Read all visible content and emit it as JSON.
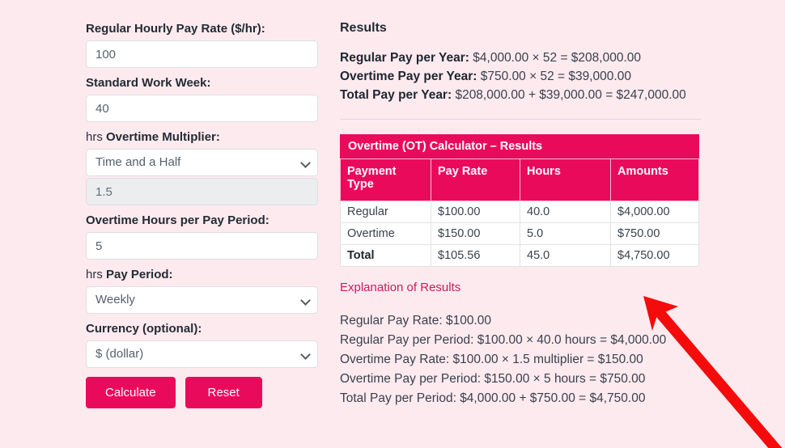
{
  "form": {
    "fields": [
      {
        "label": "Regular Hourly Pay Rate ($/hr):",
        "value": "100",
        "type": "text"
      },
      {
        "label": "Standard Work Week:",
        "value": "40",
        "type": "text"
      },
      {
        "label": "Overtime Multiplier:",
        "prefix": "hrs",
        "value": "Time and a Half",
        "type": "select"
      },
      {
        "label": "",
        "value": "1.5",
        "type": "text-disabled"
      },
      {
        "label": "Overtime Hours per Pay Period:",
        "value": "5",
        "type": "text"
      },
      {
        "label": "Pay Period:",
        "prefix": "hrs",
        "value": "Weekly",
        "type": "select"
      },
      {
        "label": "Currency (optional):",
        "value": "$ (dollar)",
        "type": "select"
      }
    ],
    "calculate_label": "Calculate",
    "reset_label": "Reset"
  },
  "results": {
    "heading": "Results",
    "summary": [
      {
        "label": "Regular Pay per Year:",
        "value": " $4,000.00 × 52 = $208,000.00"
      },
      {
        "label": "Overtime Pay per Year:",
        "value": " $750.00 × 52 = $39,000.00"
      },
      {
        "label": "Total Pay per Year:",
        "value": " $208,000.00 + $39,000.00 = $247,000.00"
      }
    ],
    "table": {
      "caption": "Overtime (OT) Calculator – Results",
      "headers": [
        "Payment Type",
        "Pay Rate",
        "Hours",
        "Amounts"
      ],
      "rows": [
        {
          "type": "Regular",
          "rate": "$100.00",
          "hours": "40.0",
          "amount": "$4,000.00"
        },
        {
          "type": "Overtime",
          "rate": "$150.00",
          "hours": "5.0",
          "amount": "$750.00"
        },
        {
          "type": "Total",
          "rate": "$105.56",
          "hours": "45.0",
          "amount": "$4,750.00"
        }
      ]
    },
    "explanation_link": "Explanation of Results",
    "explanation_lines": [
      "Regular Pay Rate: $100.00",
      "Regular Pay per Period: $100.00 × 40.0 hours = $4,000.00",
      "Overtime Pay Rate: $100.00 × 1.5 multiplier = $150.00",
      "Overtime Pay per Period: $150.00 × 5 hours = $750.00",
      "Total Pay per Period: $4,000.00 + $750.00 = $4,750.00"
    ]
  },
  "annotation": {
    "arrow_color": "#f40b0b"
  },
  "theme": {
    "background": "#fdeaef",
    "accent": "#ea0a5c",
    "link": "#c41e5c"
  }
}
